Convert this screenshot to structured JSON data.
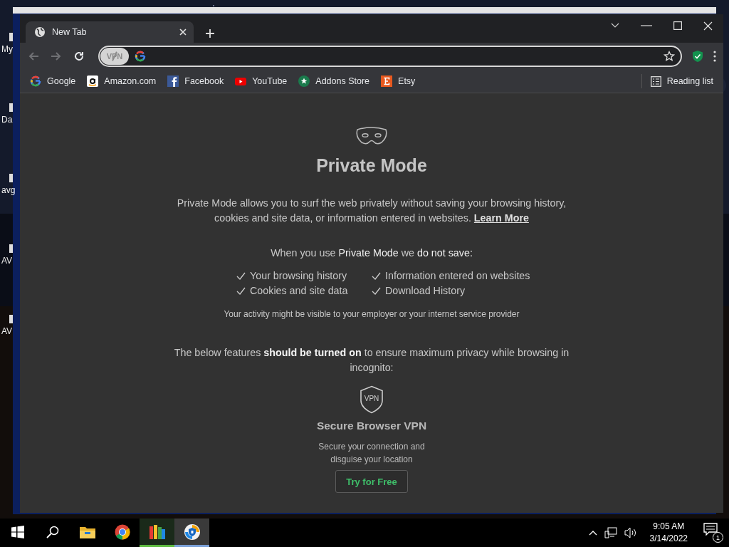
{
  "desktop": {
    "icons": [
      {
        "label": "My"
      },
      {
        "label": "Da"
      },
      {
        "label": "avg"
      },
      {
        "label": "AV"
      },
      {
        "label": "AV"
      }
    ]
  },
  "browser": {
    "tabs": [
      {
        "title": "New Tab",
        "selected": true
      }
    ],
    "nav": [
      {
        "kind": "back",
        "disabled": true
      },
      {
        "kind": "forward",
        "disabled": true
      },
      {
        "kind": "reload",
        "disabled": false
      }
    ],
    "vpn_badge": {
      "label": "VPN",
      "on": false
    },
    "bookmarks": [
      {
        "kind": "google",
        "label": "Google"
      },
      {
        "kind": "amazon",
        "label": "Amazon.com"
      },
      {
        "kind": "facebook",
        "label": "Facebook"
      },
      {
        "kind": "youtube",
        "label": "YouTube"
      },
      {
        "kind": "addons",
        "label": "Addons Store"
      },
      {
        "kind": "etsy",
        "label": "Etsy"
      }
    ],
    "reading_list": "Reading list"
  },
  "page": {
    "title": "Private Mode",
    "intro": "Private Mode allows you to surf the web privately without saving your browsing history, cookies and site data, or information entered in websites.",
    "learn_more": "Learn More",
    "not_saved_heading": "When you use **Private Mode** we **do not save:**",
    "not_saved": [
      "Your browsing history",
      "Information entered on websites",
      "Cookies and site data",
      "Download History"
    ],
    "notice": "Your activity might be visible to your employer or your internet service provider",
    "features_intro": "The below features **should be turned on** to ensure maximum privacy while browsing in incognito:",
    "feature": {
      "badge": "VPN",
      "title": "Secure Browser VPN",
      "description": "Secure your connection and disguise your location",
      "button": "Try for Free"
    }
  },
  "taskbar": {
    "apps": [
      {
        "kind": "start",
        "selected": false,
        "running": false
      },
      {
        "kind": "search",
        "selected": false,
        "running": false
      },
      {
        "kind": "explorer",
        "selected": false,
        "running": false
      },
      {
        "kind": "chrome",
        "selected": false,
        "running": false
      },
      {
        "kind": "avg",
        "selected": false,
        "running": true
      },
      {
        "kind": "securebrowser",
        "selected": true,
        "running": true
      }
    ],
    "time": "9:05 AM",
    "date": "3/14/2022",
    "notifications": "1"
  }
}
